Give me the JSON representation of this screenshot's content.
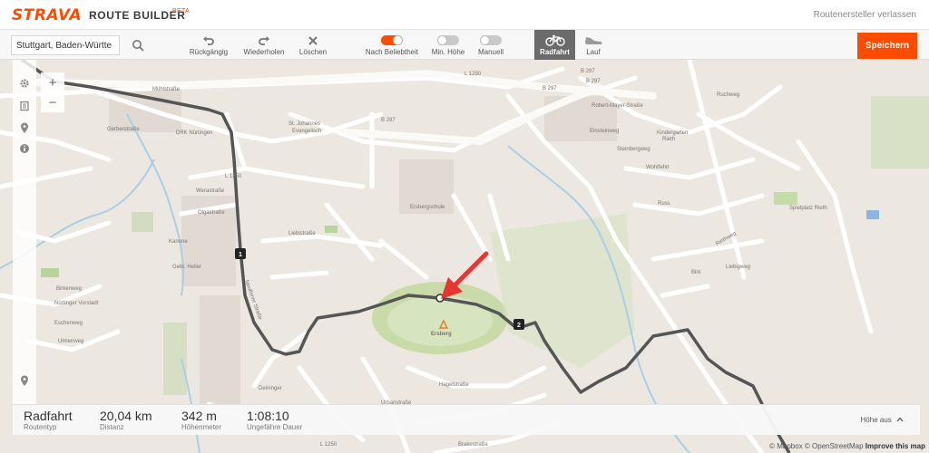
{
  "header": {
    "logo": "STRAVA",
    "product": "ROUTE BUILDER",
    "beta": "BETA",
    "leave_link": "Routenersteller verlassen"
  },
  "search": {
    "value": "Stuttgart, Baden-Württe",
    "icon": "search-icon"
  },
  "tools": {
    "undo": "Rückgängig",
    "redo": "Wiederholen",
    "clear": "Löschen",
    "popularity": "Nach Beliebtheit",
    "min_elevation": "Min. Höhe",
    "manual": "Manuell"
  },
  "sports": {
    "ride": "Radfahrt",
    "run": "Lauf"
  },
  "save_label": "Speichern",
  "colors": {
    "accent": "#fc4c02",
    "route": "#555555",
    "arrow": "#e8352f"
  },
  "map": {
    "labels": {
      "muehlstrasse": "Mühlstraße",
      "gerberstrasse": "Gerberstraße",
      "drk": "DRK Nürtingen",
      "st_johannes": "St. Johannes",
      "evangelisch": "Evangelisch",
      "l1250_a": "L 1250",
      "l1250_b": "L 1250",
      "l1250_c": "L 1250",
      "b297_a": "B 297",
      "b297_b": "B 297",
      "b297_c": "B 297",
      "b297_d": "B 297",
      "robert_mayer": "Robert-Mayer-Straße",
      "kindergarten": "Kindergarten",
      "rieth": "Rieth",
      "wohlfahrt": "Wohlfahrt",
      "weraastrasse": "Werastraße",
      "olgastrasse": "Olgastraße",
      "liebstrasse": "Lieblstraße",
      "ersbergschule": "Ersbergschule",
      "ersberg": "Ersberg",
      "kanone": "Kanone",
      "gebr_heller": "Gebr. Heller",
      "nuertinger_vorstadt": "Nürtinger Vorstadt",
      "neuffener_strasse": "Neuffener Straße",
      "spielplatz_rieth": "Spielplatz Rieth",
      "riethweg": "Riethweg",
      "liebigweg": "Liebigweg",
      "ruchweg": "Ruchweg",
      "rossweg": "Rossweg",
      "steinbergweg": "Steinbergweg",
      "einsteinweg": "Einsteinweg",
      "birk": "Birk",
      "russ": "Russ",
      "hagelstrasse": "Hagelstraße",
      "urbanstrasse": "Urbanstraße",
      "deininger": "Deininger",
      "eschenweg": "Eschenweg",
      "ulmenweg": "Ulmenweg",
      "birkenweg": "Birkenweg",
      "brakestrasse": "Brakestraße"
    },
    "markers": [
      "1",
      "2"
    ]
  },
  "stats": {
    "type_value": "Radfahrt",
    "type_caption": "Routentyp",
    "distance_value": "20,04 km",
    "distance_caption": "Distanz",
    "elevation_value": "342 m",
    "elevation_caption": "Höhenmeter",
    "duration_value": "1:08:10",
    "duration_caption": "Ungefähre Dauer",
    "elevation_toggle": "Höhe aus"
  },
  "attribution": {
    "mapbox": "© Mapbox",
    "osm": "© OpenStreetMap",
    "improve": "Improve this map"
  }
}
